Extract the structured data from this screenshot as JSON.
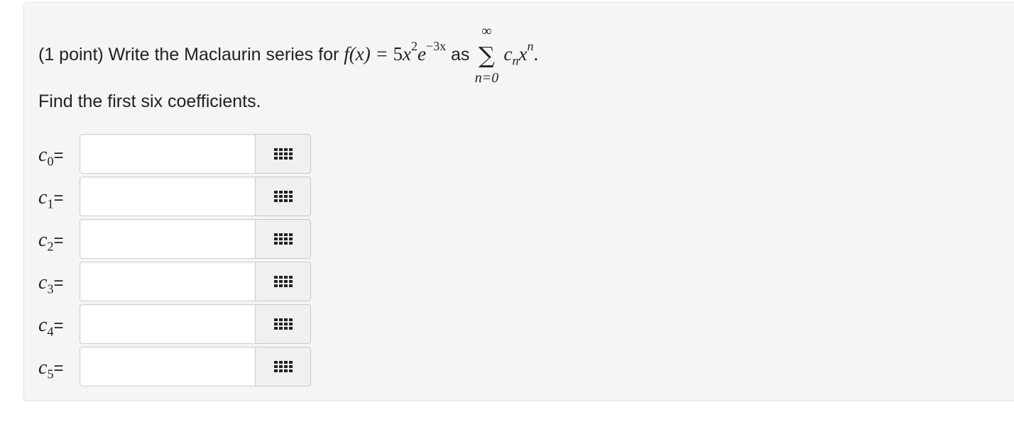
{
  "question": {
    "prefix": "(1 point) Write the Maclaurin series for",
    "function_lhs": "f(x) = ",
    "coef": "5",
    "var": "x",
    "exp1": "2",
    "base": "e",
    "exp2": "−3x",
    "as_text": "as",
    "sum_upper": "∞",
    "sum_sigma": "∑",
    "sum_lower": "n=0",
    "term_c": "c",
    "term_c_sub": "n",
    "term_x": "x",
    "term_x_sup": "n",
    "period": "."
  },
  "instruction": "Find the first six coefficients.",
  "coefficients": [
    {
      "c": "c",
      "sub": "0",
      "eq": "=",
      "value": ""
    },
    {
      "c": "c",
      "sub": "1",
      "eq": "=",
      "value": ""
    },
    {
      "c": "c",
      "sub": "2",
      "eq": "=",
      "value": ""
    },
    {
      "c": "c",
      "sub": "3",
      "eq": "=",
      "value": ""
    },
    {
      "c": "c",
      "sub": "4",
      "eq": "=",
      "value": ""
    },
    {
      "c": "c",
      "sub": "5",
      "eq": "=",
      "value": ""
    }
  ],
  "icons": {
    "equation_editor": "grid-icon"
  }
}
